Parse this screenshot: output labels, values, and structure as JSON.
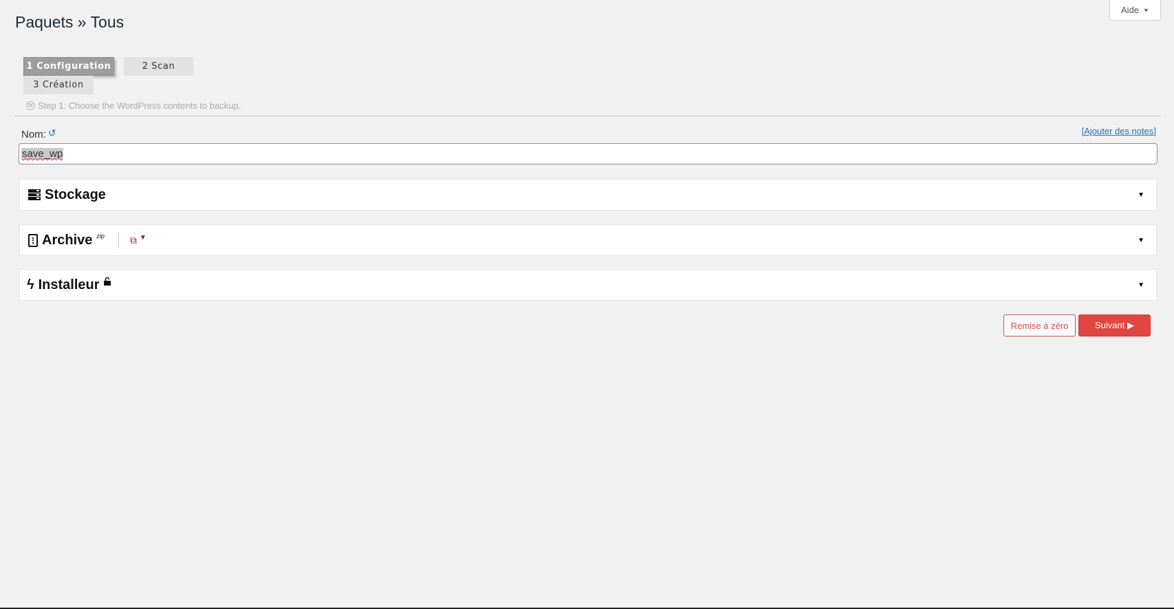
{
  "header": {
    "help_label": "Aide",
    "help_caret": "▼",
    "title": "Paquets » Tous"
  },
  "steps": [
    {
      "label": "1 Configuration",
      "active": true
    },
    {
      "label": "2 Scan",
      "active": false
    },
    {
      "label": "3 Création",
      "active": false
    }
  ],
  "step_hint": {
    "icon": "wordpress-icon",
    "text": "Step 1: Choose the WordPress contents to backup."
  },
  "name_field": {
    "label": "Nom:",
    "value": "save_wp",
    "reset_icon": "↺",
    "notes_link": "[Ajouter des notes]"
  },
  "panels": [
    {
      "title": "Stockage",
      "icon": "server-icon"
    },
    {
      "title": "Archive",
      "icon": "file-archive-icon",
      "badge": "zip",
      "extra_icons": [
        "copy-icon",
        "filter-icon"
      ]
    },
    {
      "title": "Installeur",
      "icon": "bolt-icon",
      "badge_icon": "unlock-icon"
    }
  ],
  "glyphs": {
    "caret": "▼",
    "copy": "⧉",
    "filter": "▼",
    "bolt": "ϟ",
    "lock": "🔓"
  },
  "actions": {
    "reset_label": "Remise à zéro",
    "next_label": "Suivant ▶"
  },
  "colors": {
    "accent_red": "#e0463f",
    "link_blue": "#2271b1",
    "background": "#f1f1f1"
  }
}
